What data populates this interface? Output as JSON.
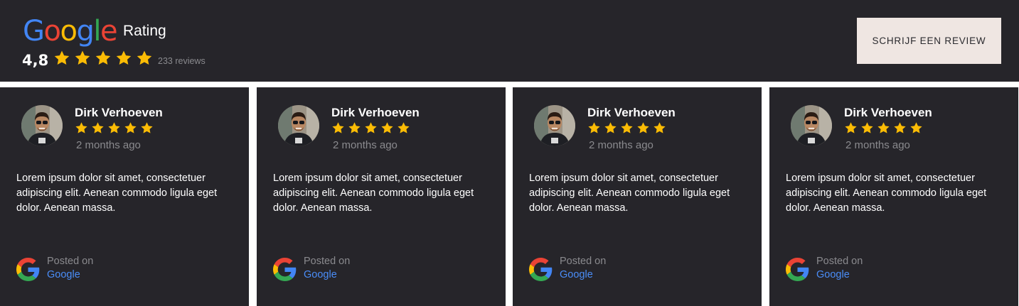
{
  "header": {
    "logo_letters": [
      {
        "char": "G",
        "color": "#4285F4"
      },
      {
        "char": "o",
        "color": "#EA4335"
      },
      {
        "char": "o",
        "color": "#FBBC05"
      },
      {
        "char": "g",
        "color": "#4285F4"
      },
      {
        "char": "l",
        "color": "#34A853"
      },
      {
        "char": "e",
        "color": "#EA4335"
      }
    ],
    "rating_label": "Rating",
    "score": "4,8",
    "stars": 5,
    "review_count": "233 reviews",
    "write_review_button": "SCHRIJF EEN REVIEW"
  },
  "reviews": [
    {
      "name": "Dirk Verhoeven",
      "stars": 5,
      "time_ago": "2 months ago",
      "text": "Lorem ipsum dolor sit amet, consectetuer adipiscing elit. Aenean commodo ligula eget dolor. Aenean massa.",
      "posted_on": "Posted on",
      "source": "Google"
    },
    {
      "name": "Dirk Verhoeven",
      "stars": 5,
      "time_ago": "2 months ago",
      "text": "Lorem ipsum dolor sit amet, consectetuer adipiscing elit. Aenean commodo ligula eget dolor. Aenean massa.",
      "posted_on": "Posted on",
      "source": "Google"
    },
    {
      "name": "Dirk Verhoeven",
      "stars": 5,
      "time_ago": "2 months ago",
      "text": "Lorem ipsum dolor sit amet, consectetuer adipiscing elit. Aenean commodo ligula eget dolor. Aenean massa.",
      "posted_on": "Posted on",
      "source": "Google"
    },
    {
      "name": "Dirk Verhoeven",
      "stars": 5,
      "time_ago": "2 months ago",
      "text": "Lorem ipsum dolor sit amet, consectetuer adipiscing elit. Aenean commodo ligula eget dolor. Aenean massa.",
      "posted_on": "Posted on",
      "source": "Google"
    }
  ],
  "colors": {
    "background": "#26252a",
    "star": "#FBBC05",
    "link": "#4a8df8",
    "button_bg": "#efe6e2"
  },
  "icons": [
    "google-logo",
    "star-icon",
    "google-g-icon",
    "avatar"
  ]
}
